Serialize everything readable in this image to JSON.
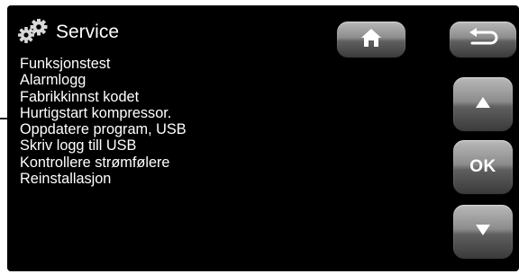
{
  "header": {
    "title": "Service",
    "icon": "gears-icon"
  },
  "menu": {
    "items": [
      "Funksjonstest",
      "Alarmlogg",
      "Fabrikkinnst kodet",
      "Hurtigstart kompressor.",
      "Oppdatere program, USB",
      "Skriv logg till USB",
      "Kontrollere strømfølere",
      "Reinstallasjon"
    ]
  },
  "buttons": {
    "home_icon": "home-icon",
    "back_icon": "back-arrow-icon",
    "up_icon": "arrow-up-icon",
    "ok_label": "OK",
    "down_icon": "arrow-down-icon"
  },
  "colors": {
    "screen_background": "#000000",
    "text": "#ffffff",
    "button_gradient_top": "#b9b9b9",
    "button_gradient_bottom": "#3a3a3a"
  }
}
